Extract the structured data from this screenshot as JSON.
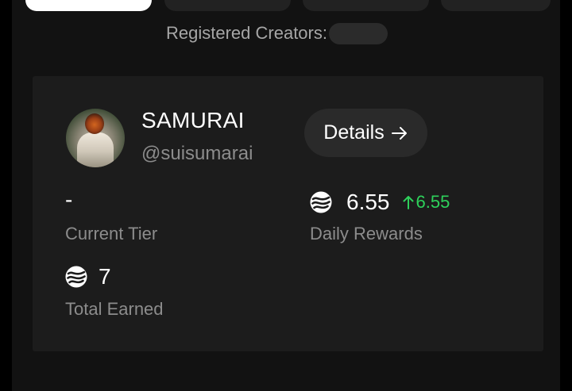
{
  "header": {
    "registered_label": "Registered Creators:"
  },
  "creator": {
    "name": "SAMURAI",
    "handle": "@suisumarai",
    "details_label": "Details",
    "stats": {
      "tier_value": "-",
      "tier_label": "Current Tier",
      "daily_value": "6.55",
      "daily_delta": "6.55",
      "daily_label": "Daily Rewards",
      "total_value": "7",
      "total_label": "Total Earned"
    }
  },
  "colors": {
    "background": "#000000",
    "panel": "#121212",
    "card": "#1c1c1c",
    "positive": "#2ed15b",
    "muted": "#8c8c8c"
  },
  "icons": {
    "token": "sui-token-icon",
    "details_arrow": "arrow-right-icon",
    "delta_arrow": "arrow-up-icon"
  }
}
